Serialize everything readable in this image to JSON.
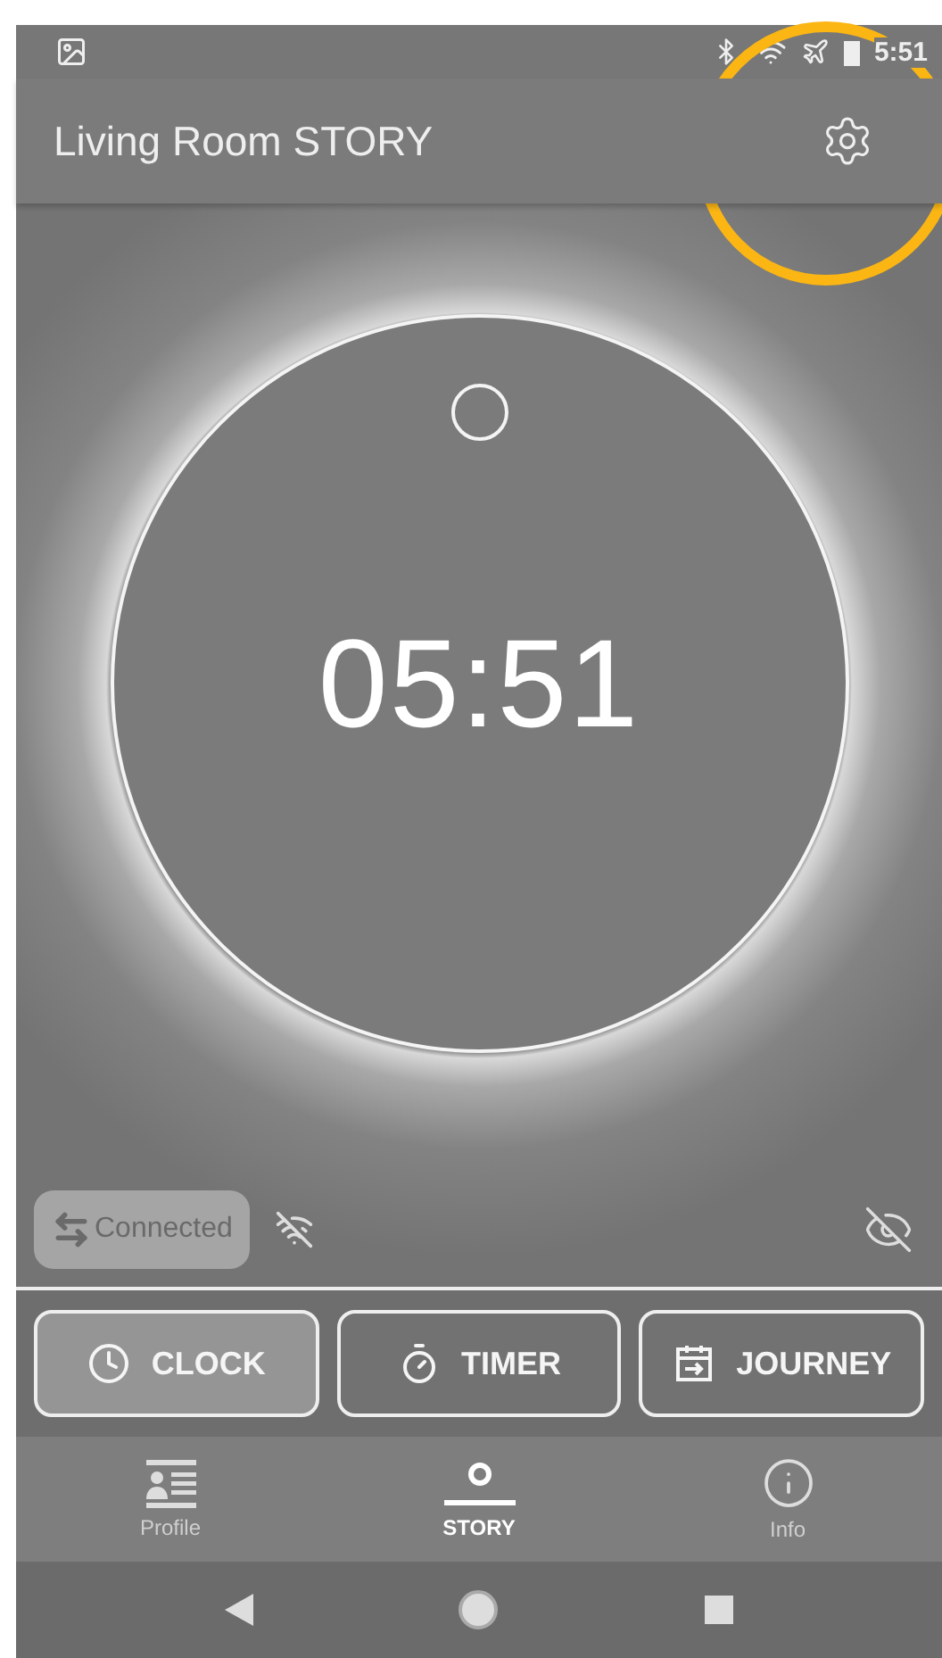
{
  "status_bar": {
    "time": "5:51"
  },
  "app_bar": {
    "title": "Living Room STORY"
  },
  "clock": {
    "time": "05:51"
  },
  "connection": {
    "label": "Connected",
    "disabled": true
  },
  "modes": [
    {
      "label": "CLOCK",
      "kind": "clock",
      "selected": true
    },
    {
      "label": "TIMER",
      "kind": "timer",
      "selected": false
    },
    {
      "label": "JOURNEY",
      "kind": "journey",
      "selected": false
    }
  ],
  "bottom_nav": [
    {
      "label": "Profile",
      "kind": "profile",
      "selected": false
    },
    {
      "label": "STORY",
      "kind": "story",
      "selected": true
    },
    {
      "label": "Info",
      "kind": "info",
      "selected": false
    }
  ]
}
